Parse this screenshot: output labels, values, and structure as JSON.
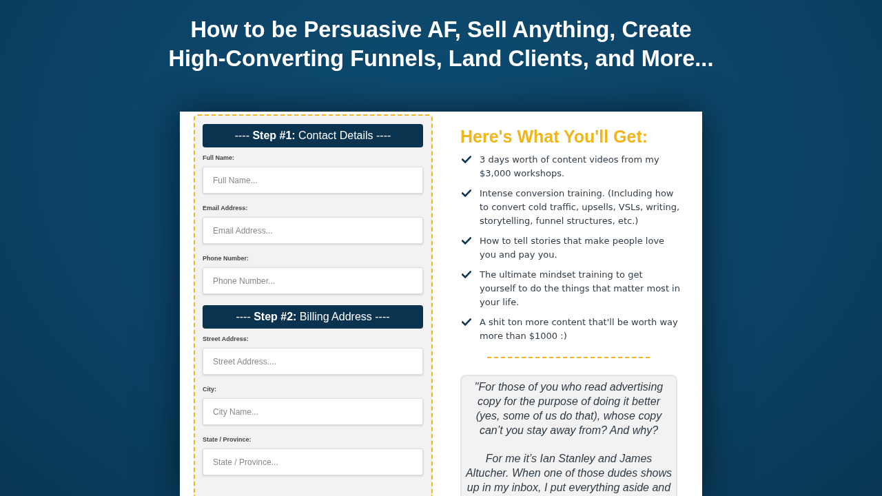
{
  "headline": "How to be Persuasive AF, Sell Anything, Create High-Converting Funnels, Land Clients, and More...",
  "order_form": {
    "sections": [
      {
        "heading": "---- **Step #1:** Contact Details ----",
        "fields": [
          {
            "label": "Full Name:",
            "placeholder": "Full Name..."
          },
          {
            "label": "Email Address:",
            "placeholder": "Email Address..."
          },
          {
            "label": "Phone Number:",
            "placeholder": "Phone Number..."
          }
        ]
      },
      {
        "heading": "---- **Step #2:** Billing Address ----",
        "fields": [
          {
            "label": "Street Address:",
            "placeholder": "Street Address...."
          },
          {
            "label": "City:",
            "placeholder": "City Name..."
          },
          {
            "label": "State / Province:",
            "placeholder": "State / Province..."
          }
        ]
      }
    ]
  },
  "benefits": {
    "title": "Here's What You'll Get:",
    "items": [
      "3 days worth of content videos from my $3,000 workshops.",
      "Intense conversion training. (Including how to convert cold traffic, upsells, VSLs, writing, storytelling, funnel structures, etc.)",
      "How to tell stories that make people love you and pay you.",
      "The ultimate mindset training to get yourself to do the things that matter most in your life.",
      "A shit ton more content that'll be worth way more than $1000 :)"
    ]
  },
  "testimonial": {
    "paragraphs": [
      "\"For those of you who read advertising copy for the purpose of doing it better (yes, some of us do that), whose copy can’t you stay away from? And why?",
      "For me it’s Ian Stanley and James Altucher. When one of those dudes shows up in my inbox, I put everything aside and"
    ]
  }
}
